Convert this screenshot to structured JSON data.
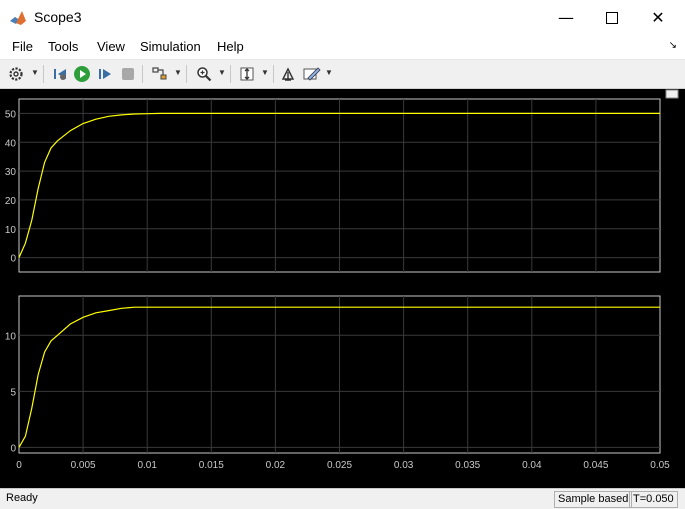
{
  "window": {
    "title": "Scope3"
  },
  "menu": {
    "items": [
      "File",
      "Tools",
      "View",
      "Simulation",
      "Help"
    ]
  },
  "toolbar": {
    "icons": [
      "gear-icon",
      "step-back-icon",
      "run-icon",
      "step-forward-icon",
      "stop-icon",
      "signal-selector-icon",
      "zoom-icon",
      "scale-axes-icon",
      "highlight-icon",
      "style-icon"
    ]
  },
  "status": {
    "ready": "Ready",
    "sample": "Sample based",
    "time": "T=0.050"
  },
  "colors": {
    "plot_bg": "#000000",
    "axes_bg": "#000000",
    "trace": "#ffff00",
    "grid": "#3a3a3a",
    "axis": "#c8c8c8",
    "tick_text": "#c8c8c8"
  },
  "chart_data": [
    {
      "type": "line",
      "title": "",
      "xlabel": "",
      "ylabel": "",
      "xlim": [
        0,
        0.05
      ],
      "ylim": [
        -5,
        55
      ],
      "yticks": [
        0,
        10,
        20,
        30,
        40,
        50
      ],
      "ytick_labels": [
        "0",
        "10",
        "20",
        "30",
        "40",
        "50"
      ],
      "grid": true,
      "series": [
        {
          "color": "#ffff00",
          "x": [
            0,
            0.0005,
            0.001,
            0.0015,
            0.002,
            0.0025,
            0.003,
            0.004,
            0.005,
            0.006,
            0.007,
            0.008,
            0.009,
            0.01,
            0.011,
            0.012,
            0.05
          ],
          "y": [
            0,
            5,
            13,
            24,
            33,
            38,
            40.5,
            44,
            46.5,
            48,
            49,
            49.5,
            49.8,
            49.9,
            50,
            50,
            50
          ]
        }
      ]
    },
    {
      "type": "line",
      "title": "",
      "xlabel": "",
      "ylabel": "",
      "xlim": [
        0,
        0.05
      ],
      "ylim": [
        -0.5,
        13.5
      ],
      "yticks": [
        0,
        5,
        10
      ],
      "ytick_labels": [
        "0",
        "5",
        "10"
      ],
      "xticks": [
        0,
        0.005,
        0.01,
        0.015,
        0.02,
        0.025,
        0.03,
        0.035,
        0.04,
        0.045,
        0.05
      ],
      "xtick_labels": [
        "0",
        "0.005",
        "0.01",
        "0.015",
        "0.02",
        "0.025",
        "0.03",
        "0.035",
        "0.04",
        "0.045",
        "0.05"
      ],
      "grid": true,
      "series": [
        {
          "color": "#ffff00",
          "x": [
            0,
            0.0005,
            0.001,
            0.0015,
            0.002,
            0.0025,
            0.003,
            0.004,
            0.005,
            0.006,
            0.007,
            0.008,
            0.009,
            0.01,
            0.012,
            0.014,
            0.05
          ],
          "y": [
            0,
            1,
            3.5,
            6.5,
            8.5,
            9.5,
            10,
            11,
            11.6,
            12,
            12.2,
            12.4,
            12.5,
            12.5,
            12.5,
            12.5,
            12.5
          ]
        }
      ]
    }
  ]
}
